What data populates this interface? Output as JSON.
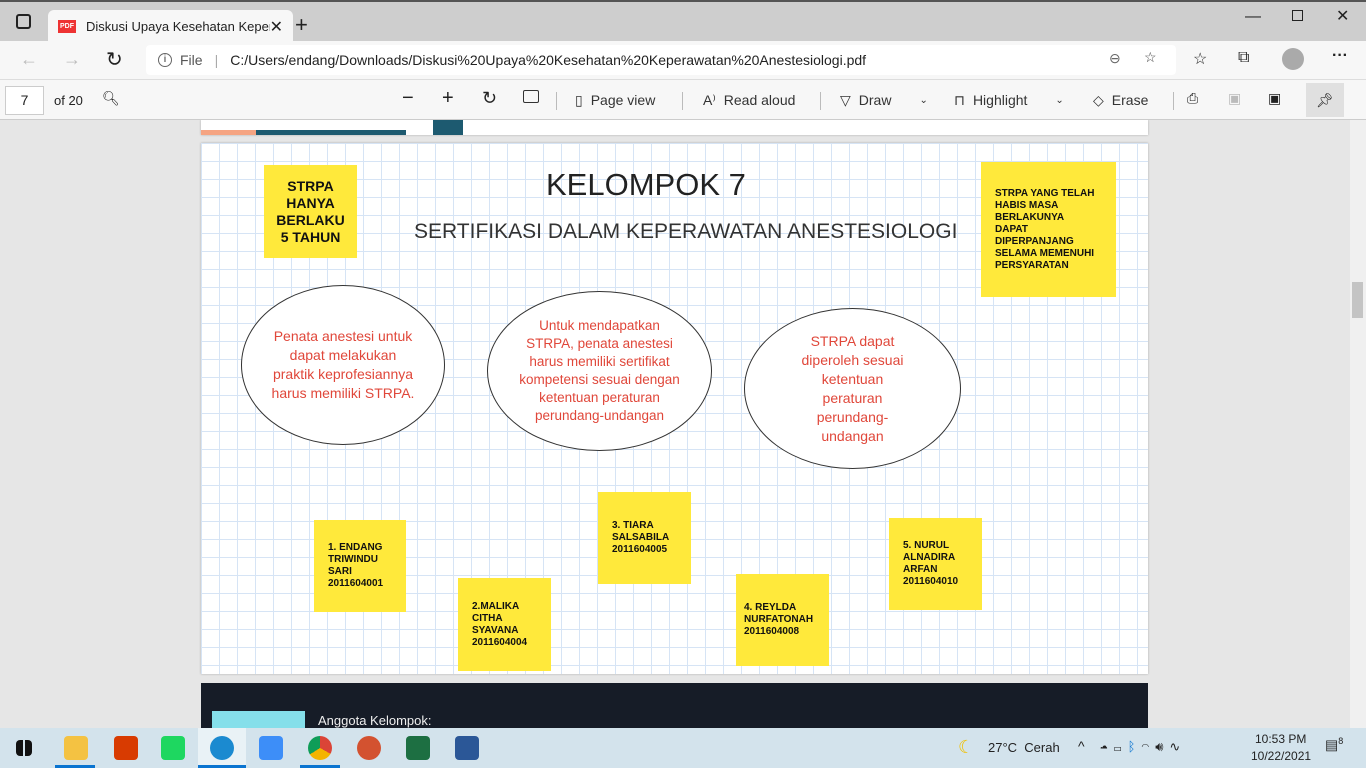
{
  "browser": {
    "tab_title": "Diskusi Upaya Kesehatan Kepera",
    "url_scheme": "File",
    "url": "C:/Users/endang/Downloads/Diskusi%20Upaya%20Kesehatan%20Keperawatan%20Anestesiologi.pdf"
  },
  "pdf_toolbar": {
    "page": "7",
    "of": "of 20",
    "page_view": "Page view",
    "read_aloud": "Read aloud",
    "draw": "Draw",
    "highlight": "Highlight",
    "erase": "Erase"
  },
  "slide": {
    "title": "KELOMPOK 7",
    "subtitle": "SERTIFIKASI DALAM KEPERAWATAN ANESTESIOLOGI",
    "note_left": "STRPA\nHANYA\nBERLAKU\n5 TAHUN",
    "note_right": "STRPA YANG TELAH\nHABIS MASA\nBERLAKUNYA\nDAPAT\nDIPERPANJANG\nSELAMA MEMENUHI\nPERSYARATAN",
    "ellipses": [
      "Penata anestesi untuk dapat melakukan praktik keprofesiannya harus memiliki STRPA.",
      "Untuk mendapatkan STRPA, penata anestesi harus memiliki sertifikat kompetensi sesuai dengan ketentuan peraturan perundang-undangan",
      "STRPA dapat diperoleh sesuai ketentuan peraturan perundang-undangan"
    ],
    "members": [
      "1. ENDANG\nTRIWINDU\nSARI\n2011604001",
      "2.MALIKA\nCITHA\nSYAVANA\n2011604004",
      "3. TIARA\nSALSABILA\n2011604005",
      "4. REYLDA\nNURFATONAH\n2011604008",
      "5. NURUL\nALNADIRA\nARFAN\n2011604010"
    ]
  },
  "next_page": {
    "label": "Anggota Kelompok:"
  },
  "taskbar": {
    "weather": "27°C  Cerah",
    "time": "10:53 PM",
    "date": "10/22/2021",
    "notifications": "8"
  },
  "colors": {
    "note": "#ffe93b",
    "ellipse_text": "#e0473a",
    "grid": "#d6e4f5"
  }
}
